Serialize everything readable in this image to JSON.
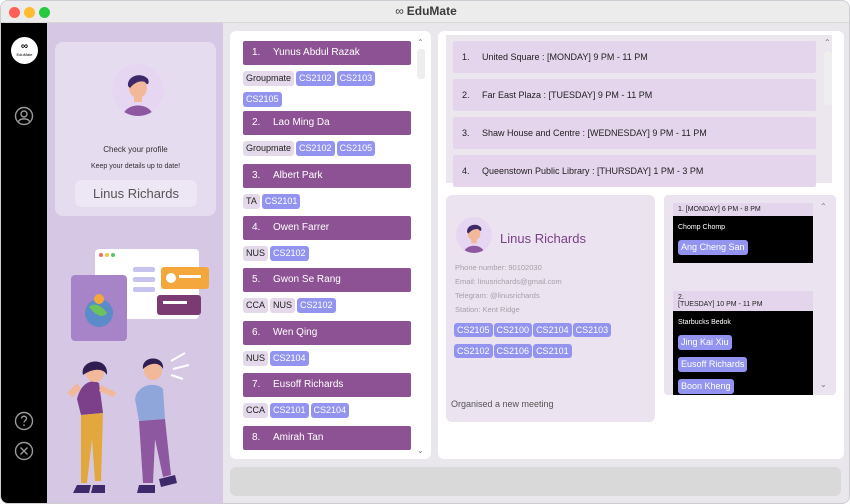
{
  "window": {
    "title": "EduMate",
    "title_glyph": "∞"
  },
  "sidebar": {
    "logo_mark": "∞",
    "logo_text": "EduMate",
    "icons": [
      "profile-icon",
      "help-icon",
      "close-icon"
    ]
  },
  "profile": {
    "check_text": "Check your profile",
    "keep_text": "Keep your details up to date!",
    "name_box": "Linus Richards"
  },
  "contacts": [
    {
      "index": "1.",
      "name": "Yunus Abdul Razak",
      "tags": [
        {
          "t": "Groupmate",
          "k": "plain"
        },
        {
          "t": "CS2102",
          "k": "mod"
        },
        {
          "t": "CS2103",
          "k": "mod"
        },
        {
          "t": "CS2105",
          "k": "mod"
        }
      ]
    },
    {
      "index": "2.",
      "name": "Lao Ming Da",
      "tags": [
        {
          "t": "Groupmate",
          "k": "plain"
        },
        {
          "t": "CS2102",
          "k": "mod"
        },
        {
          "t": "CS2105",
          "k": "mod"
        }
      ]
    },
    {
      "index": "3.",
      "name": "Albert Park",
      "tags": [
        {
          "t": "TA",
          "k": "plain"
        },
        {
          "t": "CS2101",
          "k": "mod"
        }
      ]
    },
    {
      "index": "4.",
      "name": "Owen Farrer",
      "tags": [
        {
          "t": "NUS",
          "k": "plain"
        },
        {
          "t": "CS2102",
          "k": "mod"
        }
      ]
    },
    {
      "index": "5.",
      "name": "Gwon Se Rang",
      "tags": [
        {
          "t": "CCA",
          "k": "plain"
        },
        {
          "t": "NUS",
          "k": "plain"
        },
        {
          "t": "CS2102",
          "k": "mod"
        }
      ]
    },
    {
      "index": "6.",
      "name": "Wen Qing",
      "tags": [
        {
          "t": "NUS",
          "k": "plain"
        },
        {
          "t": "CS2104",
          "k": "mod"
        }
      ]
    },
    {
      "index": "7.",
      "name": "Eusoff Richards",
      "tags": [
        {
          "t": "CCA",
          "k": "plain"
        },
        {
          "t": "CS2101",
          "k": "mod"
        },
        {
          "t": "CS2104",
          "k": "mod"
        }
      ]
    },
    {
      "index": "8.",
      "name": "Amirah Tan",
      "tags": []
    }
  ],
  "locations": [
    {
      "index": "1.",
      "text": "United Square : [MONDAY] 9 PM - 11 PM"
    },
    {
      "index": "2.",
      "text": "Far East Plaza : [TUESDAY] 9 PM - 11 PM"
    },
    {
      "index": "3.",
      "text": "Shaw House and Centre : [WEDNESDAY] 9 PM - 11 PM"
    },
    {
      "index": "4.",
      "text": "Queenstown Public Library : [THURSDAY] 1 PM - 3 PM"
    }
  ],
  "person": {
    "name": "Linus Richards",
    "phone": "Phone number: 90102030",
    "email": "Email: linusrichards@gmail.com",
    "telegram": "Telegram: @linusrichards",
    "station": "Station: Kent Ridge",
    "modules": [
      "CS2105",
      "CS2100",
      "CS2104",
      "CS2103",
      "CS2102",
      "CS2106",
      "CS2101"
    ]
  },
  "meetings": [
    {
      "header": "1. [MONDAY] 6 PM - 8 PM",
      "place": "Chomp Chomp",
      "people": [
        "Ang Cheng San"
      ]
    },
    {
      "header_num": "2.",
      "header": "[TUESDAY] 10 PM - 11 PM",
      "place": "Starbucks Bedok",
      "people": [
        "Jing Kai Xiu",
        "Eusoff Richards",
        "Boon Kheng"
      ]
    }
  ],
  "status_text": "Organised a new meeting",
  "command_box": {
    "value": ""
  },
  "colors": {
    "accent_purple": "#8c5293",
    "module_tag": "#9394ef",
    "panel_lilac": "#d6c7e4",
    "sidebar_black": "#000000"
  }
}
